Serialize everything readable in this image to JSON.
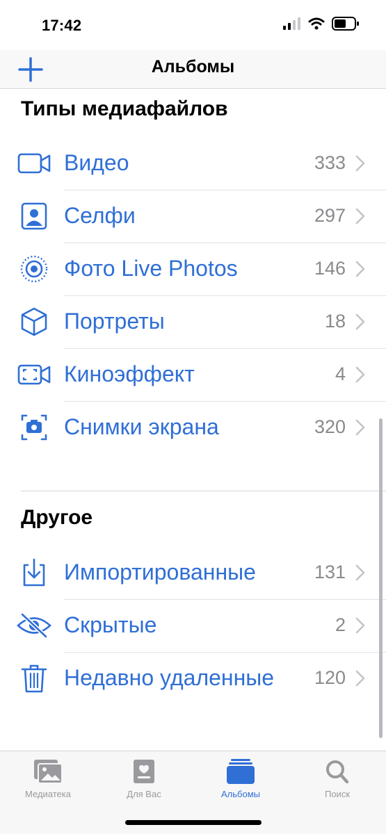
{
  "status": {
    "time": "17:42"
  },
  "nav": {
    "title": "Альбомы"
  },
  "media_types": {
    "title": "Типы медиафайлов",
    "items": [
      {
        "label": "Видео",
        "count": "333",
        "icon": "video-icon"
      },
      {
        "label": "Селфи",
        "count": "297",
        "icon": "selfie-icon"
      },
      {
        "label": "Фото Live Photos",
        "count": "146",
        "icon": "live-photo-icon"
      },
      {
        "label": "Портреты",
        "count": "18",
        "icon": "portrait-cube-icon"
      },
      {
        "label": "Киноэффект",
        "count": "4",
        "icon": "cinematic-icon"
      },
      {
        "label": "Снимки экрана",
        "count": "320",
        "icon": "screenshot-icon"
      }
    ]
  },
  "other": {
    "title": "Другое",
    "items": [
      {
        "label": "Импортированные",
        "count": "131",
        "icon": "import-icon"
      },
      {
        "label": "Скрытые",
        "count": "2",
        "icon": "hidden-eye-icon"
      },
      {
        "label": "Недавно удаленные",
        "count": "120",
        "icon": "trash-icon"
      }
    ]
  },
  "tabs": [
    {
      "label": "Медиатека",
      "icon": "library-icon",
      "active": false
    },
    {
      "label": "Для Вас",
      "icon": "for-you-icon",
      "active": false
    },
    {
      "label": "Альбомы",
      "icon": "albums-icon",
      "active": true
    },
    {
      "label": "Поиск",
      "icon": "search-icon",
      "active": false
    }
  ],
  "colors": {
    "accent": "#2f6fd6",
    "count": "#8a8a8e",
    "inactive_tab": "#9a9a9e"
  }
}
